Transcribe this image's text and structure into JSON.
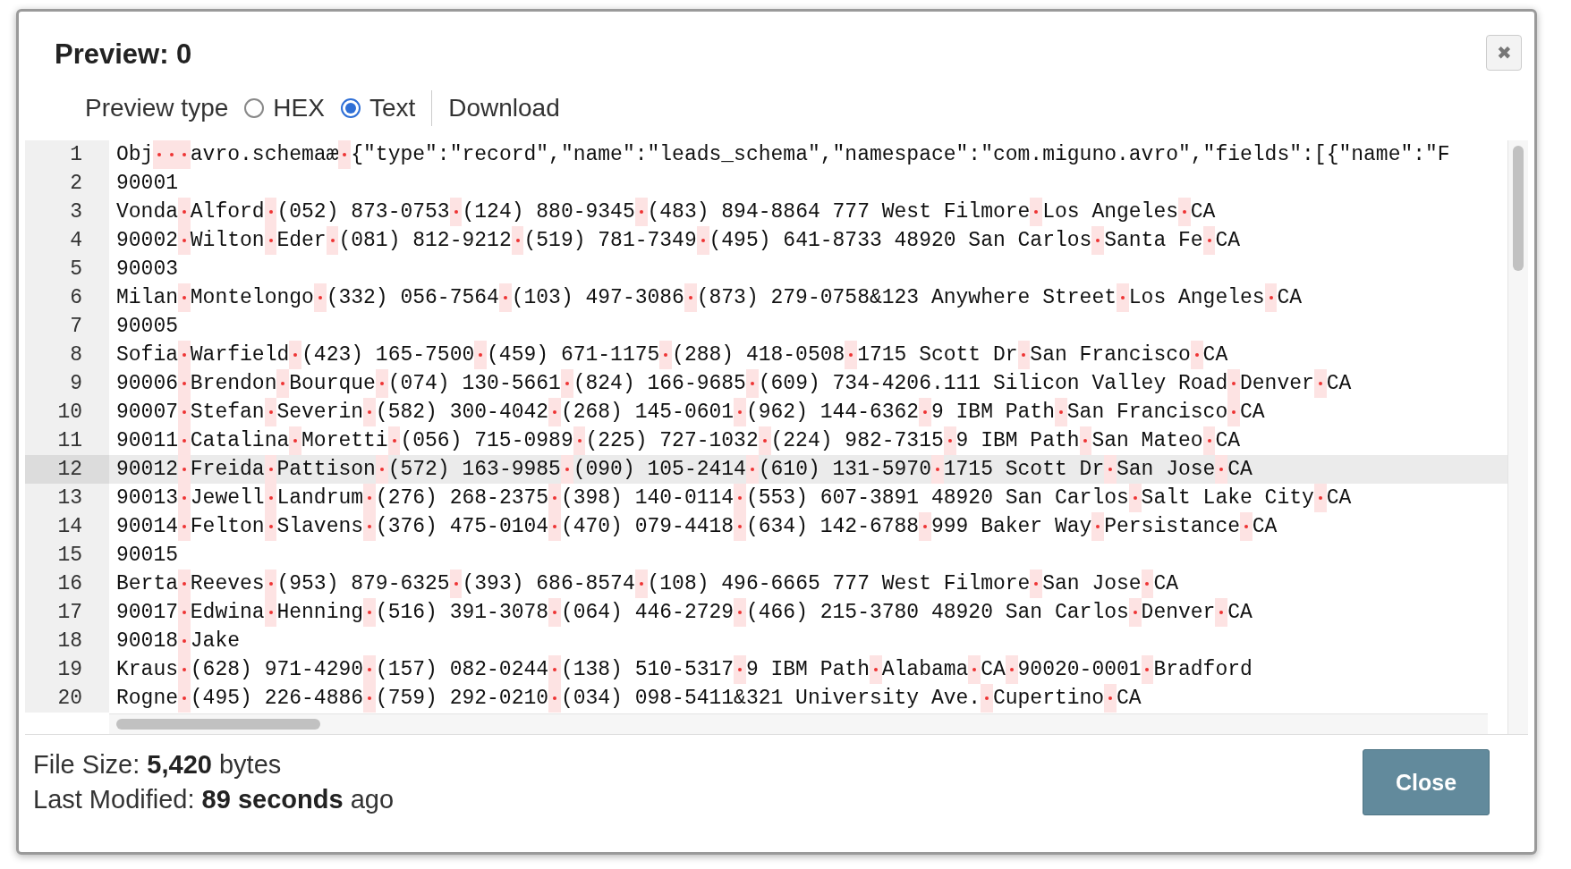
{
  "dialog": {
    "title": "Preview: 0",
    "close_icon": "✖"
  },
  "preview_type": {
    "label": "Preview type",
    "options": [
      {
        "label": "HEX",
        "selected": false
      },
      {
        "label": "Text",
        "selected": true
      }
    ],
    "download": "Download"
  },
  "lines": [
    {
      "number": "1",
      "selected": false,
      "segments": [
        "Obj",
        {
          "kind": "control"
        },
        {
          "kind": "control"
        },
        {
          "kind": "control"
        },
        "avro.schemaæ",
        {
          "kind": "control"
        },
        "{\"type\":\"record\",\"name\":\"leads_schema\",\"namespace\":\"com.miguno.avro\",\"fields\":[{\"name\":\"F"
      ]
    },
    {
      "number": "2",
      "selected": false,
      "segments": [
        "90001"
      ]
    },
    {
      "number": "3",
      "selected": false,
      "segments": [
        "Vonda",
        {
          "kind": "control"
        },
        "Alford",
        {
          "kind": "control"
        },
        "(052) 873-0753",
        {
          "kind": "control"
        },
        "(124) 880-9345",
        {
          "kind": "control"
        },
        "(483) 894-8864 777 West Filmore",
        {
          "kind": "control"
        },
        "Los Angeles",
        {
          "kind": "control"
        },
        "CA"
      ]
    },
    {
      "number": "4",
      "selected": false,
      "segments": [
        "90002",
        {
          "kind": "control"
        },
        "Wilton",
        {
          "kind": "control"
        },
        "Eder",
        {
          "kind": "control"
        },
        "(081) 812-9212",
        {
          "kind": "control"
        },
        "(519) 781-7349",
        {
          "kind": "control"
        },
        "(495) 641-8733 48920 San Carlos",
        {
          "kind": "control"
        },
        "Santa Fe",
        {
          "kind": "control"
        },
        "CA"
      ]
    },
    {
      "number": "5",
      "selected": false,
      "segments": [
        "90003"
      ]
    },
    {
      "number": "6",
      "selected": false,
      "segments": [
        "Milan",
        {
          "kind": "control"
        },
        "Montelongo",
        {
          "kind": "control"
        },
        "(332) 056-7564",
        {
          "kind": "control"
        },
        "(103) 497-3086",
        {
          "kind": "control"
        },
        "(873) 279-0758&123 Anywhere Street",
        {
          "kind": "control"
        },
        "Los Angeles",
        {
          "kind": "control"
        },
        "CA"
      ]
    },
    {
      "number": "7",
      "selected": false,
      "segments": [
        "90005"
      ]
    },
    {
      "number": "8",
      "selected": false,
      "segments": [
        "Sofia",
        {
          "kind": "control"
        },
        "Warfield",
        {
          "kind": "control"
        },
        "(423) 165-7500",
        {
          "kind": "control"
        },
        "(459) 671-1175",
        {
          "kind": "control"
        },
        "(288) 418-0508",
        {
          "kind": "control"
        },
        "1715 Scott Dr",
        {
          "kind": "control"
        },
        "San Francisco",
        {
          "kind": "control"
        },
        "CA"
      ]
    },
    {
      "number": "9",
      "selected": false,
      "segments": [
        "90006",
        {
          "kind": "control"
        },
        "Brendon",
        {
          "kind": "control"
        },
        "Bourque",
        {
          "kind": "control"
        },
        "(074) 130-5661",
        {
          "kind": "control"
        },
        "(824) 166-9685",
        {
          "kind": "control"
        },
        "(609) 734-4206.111 Silicon Valley Road",
        {
          "kind": "control"
        },
        "Denver",
        {
          "kind": "control"
        },
        "CA"
      ]
    },
    {
      "number": "10",
      "selected": false,
      "segments": [
        "90007",
        {
          "kind": "control"
        },
        "Stefan",
        {
          "kind": "control"
        },
        "Severin",
        {
          "kind": "control"
        },
        "(582) 300-4042",
        {
          "kind": "control"
        },
        "(268) 145-0601",
        {
          "kind": "control"
        },
        "(962) 144-6362",
        {
          "kind": "control"
        },
        "9 IBM Path",
        {
          "kind": "control"
        },
        "San Francisco",
        {
          "kind": "control"
        },
        "CA"
      ]
    },
    {
      "number": "11",
      "selected": false,
      "segments": [
        "90011",
        {
          "kind": "control"
        },
        "Catalina",
        {
          "kind": "control"
        },
        "Moretti",
        {
          "kind": "control"
        },
        "(056) 715-0989",
        {
          "kind": "control"
        },
        "(225) 727-1032",
        {
          "kind": "control"
        },
        "(224) 982-7315",
        {
          "kind": "control"
        },
        "9 IBM Path",
        {
          "kind": "control"
        },
        "San Mateo",
        {
          "kind": "control"
        },
        "CA"
      ]
    },
    {
      "number": "12",
      "selected": true,
      "segments": [
        "90012",
        {
          "kind": "control"
        },
        "Freida",
        {
          "kind": "control"
        },
        "Pattison",
        {
          "kind": "control"
        },
        "(572) 163-9985",
        {
          "kind": "control"
        },
        "(090) 105-2414",
        {
          "kind": "control"
        },
        "(610) 131-5970",
        {
          "kind": "control"
        },
        "1715 Scott Dr",
        {
          "kind": "control"
        },
        "San Jose",
        {
          "kind": "control"
        },
        "CA"
      ]
    },
    {
      "number": "13",
      "selected": false,
      "segments": [
        "90013",
        {
          "kind": "control"
        },
        "Jewell",
        {
          "kind": "control"
        },
        "Landrum",
        {
          "kind": "control"
        },
        "(276) 268-2375",
        {
          "kind": "control"
        },
        "(398) 140-0114",
        {
          "kind": "control"
        },
        "(553) 607-3891 48920 San Carlos",
        {
          "kind": "control"
        },
        "Salt Lake City",
        {
          "kind": "control"
        },
        "CA"
      ]
    },
    {
      "number": "14",
      "selected": false,
      "segments": [
        "90014",
        {
          "kind": "control"
        },
        "Felton",
        {
          "kind": "control"
        },
        "Slavens",
        {
          "kind": "control"
        },
        "(376) 475-0104",
        {
          "kind": "control"
        },
        "(470) 079-4418",
        {
          "kind": "control"
        },
        "(634) 142-6788",
        {
          "kind": "control"
        },
        "999 Baker Way",
        {
          "kind": "control"
        },
        "Persistance",
        {
          "kind": "control"
        },
        "CA"
      ]
    },
    {
      "number": "15",
      "selected": false,
      "segments": [
        "90015"
      ]
    },
    {
      "number": "16",
      "selected": false,
      "segments": [
        "Berta",
        {
          "kind": "control"
        },
        "Reeves",
        {
          "kind": "control"
        },
        "(953) 879-6325",
        {
          "kind": "control"
        },
        "(393) 686-8574",
        {
          "kind": "control"
        },
        "(108) 496-6665 777 West Filmore",
        {
          "kind": "control"
        },
        "San Jose",
        {
          "kind": "control"
        },
        "CA"
      ]
    },
    {
      "number": "17",
      "selected": false,
      "segments": [
        "90017",
        {
          "kind": "control"
        },
        "Edwina",
        {
          "kind": "control"
        },
        "Henning",
        {
          "kind": "control"
        },
        "(516) 391-3078",
        {
          "kind": "control"
        },
        "(064) 446-2729",
        {
          "kind": "control"
        },
        "(466) 215-3780 48920 San Carlos",
        {
          "kind": "control"
        },
        "Denver",
        {
          "kind": "control"
        },
        "CA"
      ]
    },
    {
      "number": "18",
      "selected": false,
      "segments": [
        "90018",
        {
          "kind": "control"
        },
        "Jake"
      ]
    },
    {
      "number": "19",
      "selected": false,
      "segments": [
        "Kraus",
        {
          "kind": "control"
        },
        "(628) 971-4290",
        {
          "kind": "control"
        },
        "(157) 082-0244",
        {
          "kind": "control"
        },
        "(138) 510-5317",
        {
          "kind": "control"
        },
        "9 IBM Path",
        {
          "kind": "control"
        },
        "Alabama",
        {
          "kind": "control"
        },
        "CA",
        {
          "kind": "control"
        },
        "90020-0001",
        {
          "kind": "control"
        },
        "Bradford"
      ]
    },
    {
      "number": "20",
      "selected": false,
      "segments": [
        "Rogne",
        {
          "kind": "control"
        },
        "(495) 226-4886",
        {
          "kind": "control"
        },
        "(759) 292-0210",
        {
          "kind": "control"
        },
        "(034) 098-5411&321 University Ave.",
        {
          "kind": "control"
        },
        "Cupertino",
        {
          "kind": "control"
        },
        "CA"
      ]
    }
  ],
  "footer": {
    "file_size": "File Size: **5,420** bytes",
    "last_modified": "Last Modified: **89 seconds** ago",
    "close_button": "Close"
  }
}
